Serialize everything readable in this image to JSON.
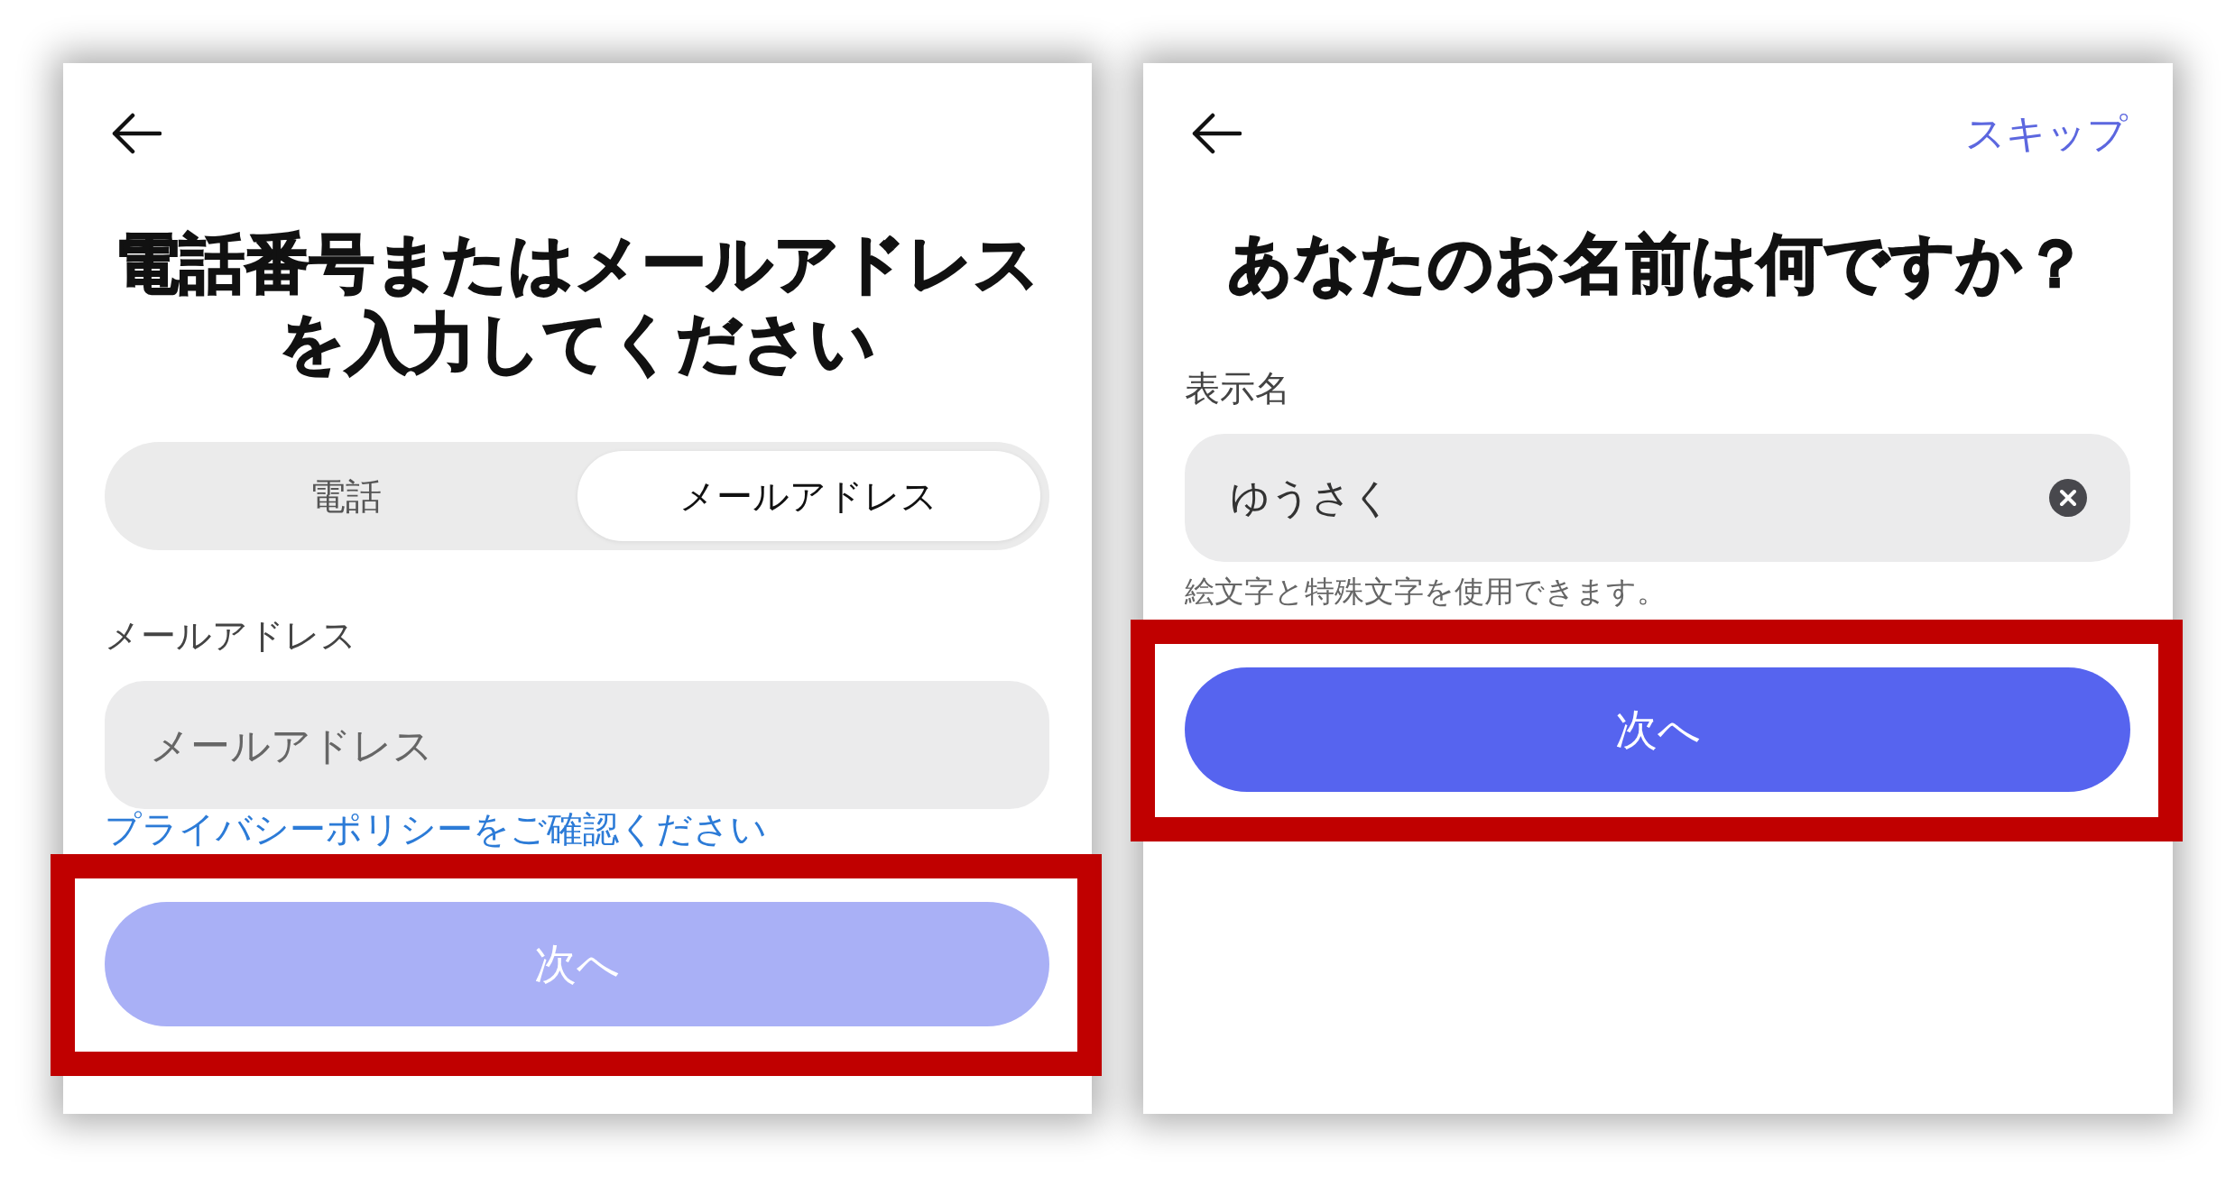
{
  "screens": [
    {
      "title": "電話番号またはメールアドレスを入力してください",
      "tabs": [
        {
          "label": "電話",
          "selected": false
        },
        {
          "label": "メールアドレス",
          "selected": true
        }
      ],
      "field": {
        "label": "メールアドレス",
        "placeholder": "メールアドレス"
      },
      "note": {
        "kind": "link",
        "text": "プライバシーポリシーをご確認ください"
      },
      "next_button": {
        "label": "次へ",
        "disabled": true,
        "highlighted": true
      }
    },
    {
      "skip_link": "スキップ",
      "title": "あなたのお名前は何ですか？",
      "field": {
        "label": "表示名",
        "value": "ゆうさく"
      },
      "note": {
        "kind": "hint",
        "text": "絵文字と特殊文字を使用できます。"
      },
      "next_button": {
        "label": "次へ",
        "disabled": false,
        "highlighted": true
      }
    }
  ]
}
